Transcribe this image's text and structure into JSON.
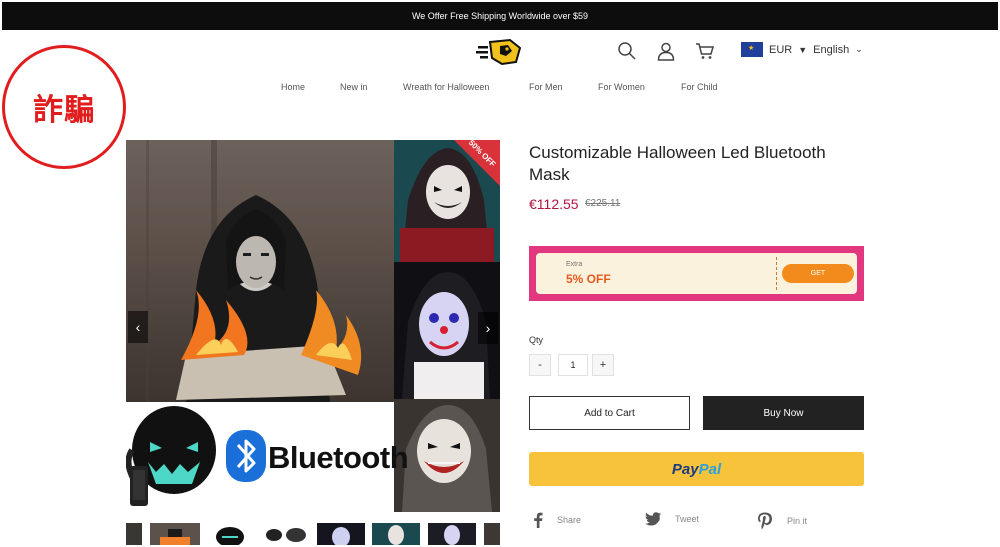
{
  "announcement": "We Offer Free Shipping Worldwide over $59",
  "stamp_text": "詐騙",
  "header": {
    "logo_icon": "brand-logo-icon",
    "icons": [
      "search-icon",
      "user-icon",
      "cart-icon"
    ],
    "currency": "EUR",
    "language": "English"
  },
  "nav": {
    "items": [
      "Home",
      "New in",
      "Wreath for Halloween",
      "For Men",
      "For Women",
      "For Child"
    ]
  },
  "gallery": {
    "badge": "50% OFF",
    "bluetooth_label": "Bluetooth",
    "prev_icon": "chevron-left-icon",
    "next_icon": "chevron-right-icon"
  },
  "product": {
    "title": "Customizable Halloween Led Bluetooth Mask",
    "price": "€112.55",
    "old_price": "€225.11"
  },
  "coupon": {
    "label": "Extra",
    "discount": "5% OFF",
    "button": "GET"
  },
  "quantity": {
    "label": "Qty",
    "minus": "-",
    "value": "1",
    "plus": "+"
  },
  "buttons": {
    "add_to_cart": "Add to Cart",
    "buy_now": "Buy Now",
    "paypal_a": "Pay",
    "paypal_b": "Pal"
  },
  "share": {
    "share": "Share",
    "tweet": "Tweet",
    "pin": "Pin it"
  },
  "colors": {
    "price": "#b3123f",
    "coupon_border": "#e2377f",
    "coupon_button": "#f38b1c",
    "paypal": "#f7c33a",
    "stamp": "#e11d1d"
  }
}
